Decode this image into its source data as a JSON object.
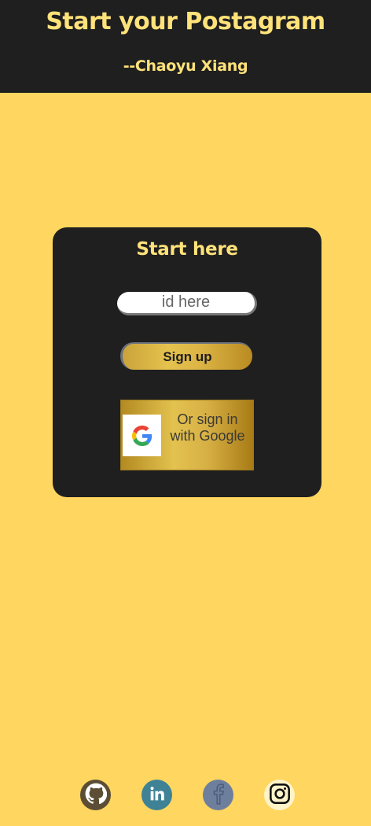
{
  "header": {
    "title": "Start your Postagram",
    "subtitle": "--Chaoyu Xiang"
  },
  "card": {
    "title": "Start here",
    "id_input": {
      "placeholder": "id here",
      "value": ""
    },
    "signup_label": "Sign up",
    "google_label": "Or sign in with Google"
  },
  "socials": [
    {
      "name": "github",
      "icon": "github-icon"
    },
    {
      "name": "linkedin",
      "icon": "linkedin-icon"
    },
    {
      "name": "facebook",
      "icon": "facebook-icon"
    },
    {
      "name": "instagram",
      "icon": "instagram-icon"
    }
  ],
  "colors": {
    "page_background": "#ffd65f",
    "dark_panel": "#1f1f1f",
    "accent_text": "#ffe27a",
    "gold": "#d9b445"
  }
}
